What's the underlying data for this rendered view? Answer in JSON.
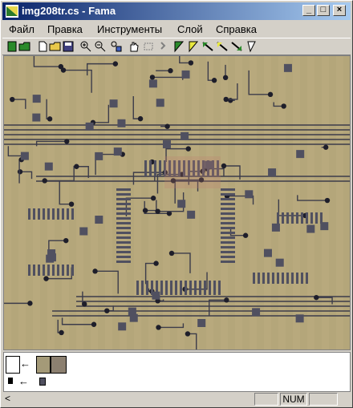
{
  "window": {
    "title": "img208tr.cs - Fama"
  },
  "menu": {
    "items": [
      "Файл",
      "Правка",
      "Инструменты",
      "Слой",
      "Справка"
    ]
  },
  "toolbar": {
    "tools": [
      "new-icon",
      "open-icon",
      "new-doc-icon",
      "open-folder-icon",
      "save-icon",
      "zoom-in-icon",
      "zoom-out-icon",
      "fit-icon",
      "hand-icon",
      "select-rect-icon",
      "undo-icon",
      "fill-green-icon",
      "fill-yellow-icon",
      "line-tool-1-icon",
      "line-tool-2-icon",
      "line-tool-3-icon",
      "pen-icon"
    ]
  },
  "colors": {
    "title_start": "#0a246a",
    "board": "#b4a67a",
    "trace": "#3c3c4a",
    "pad": "#505060"
  },
  "layers": {
    "arrow1": "←",
    "arrow2": "←"
  },
  "statusbar": {
    "left": "<",
    "num": "NUM"
  }
}
